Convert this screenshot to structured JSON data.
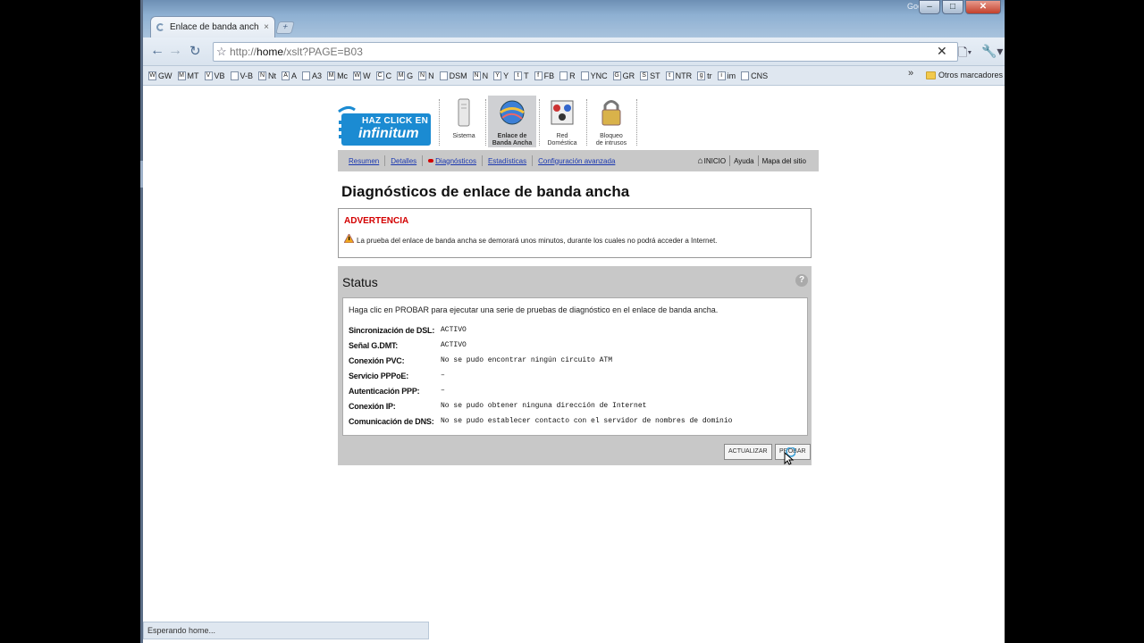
{
  "browser": {
    "tab_title": "Enlace de banda ancha: ...",
    "tab_close": "×",
    "new_tab": "+",
    "corner_label": "Google",
    "win_min": "–",
    "win_max": "□",
    "win_close": "✕",
    "url_prefix": "http://",
    "url_host": "home",
    "url_path": "/xslt?PAGE=B03",
    "omnibox_clear": "✕",
    "page_menu": "🗋▾",
    "wrench": "🔧▾",
    "bookmarks": [
      {
        "icon": "W",
        "label": "GW"
      },
      {
        "icon": "M",
        "label": "MT"
      },
      {
        "icon": "V",
        "label": "VB"
      },
      {
        "icon": "",
        "label": "V-B"
      },
      {
        "icon": "N",
        "label": "Nt"
      },
      {
        "icon": "A",
        "label": "A"
      },
      {
        "icon": "",
        "label": "A3"
      },
      {
        "icon": "M",
        "label": "Mc"
      },
      {
        "icon": "W",
        "label": "W"
      },
      {
        "icon": "C",
        "label": "C"
      },
      {
        "icon": "M",
        "label": "G"
      },
      {
        "icon": "N",
        "label": "N"
      },
      {
        "icon": "",
        "label": "DSM"
      },
      {
        "icon": "N",
        "label": "N"
      },
      {
        "icon": "Y",
        "label": "Y"
      },
      {
        "icon": "t",
        "label": "T"
      },
      {
        "icon": "f",
        "label": "FB"
      },
      {
        "icon": "",
        "label": "R"
      },
      {
        "icon": "",
        "label": "YNC"
      },
      {
        "icon": "G",
        "label": "GR"
      },
      {
        "icon": "S",
        "label": "ST"
      },
      {
        "icon": "t",
        "label": "NTR"
      },
      {
        "icon": "g",
        "label": "tr"
      },
      {
        "icon": "i",
        "label": "im"
      },
      {
        "icon": "",
        "label": "CNS"
      }
    ],
    "bookmarks_more": "»",
    "bookmarks_other": "Otros marcadores",
    "status_text": "Esperando home..."
  },
  "logo": {
    "line1": "HAZ CLICK EN",
    "line2": "infinitum"
  },
  "topnav": [
    {
      "line1": "Sistema",
      "line2": ""
    },
    {
      "line1": "Enlace de",
      "line2": "Banda Ancha"
    },
    {
      "line1": "Red",
      "line2": "Doméstica"
    },
    {
      "line1": "Bloqueo",
      "line2": "de intrusos"
    }
  ],
  "subnav": {
    "items": [
      "Resumen",
      "Detalles",
      "Diagnósticos",
      "Estadísticas",
      "Configuración avanzada"
    ],
    "inicio": "INICIO",
    "ayuda": "Ayuda",
    "mapa": "Mapa del sitio"
  },
  "page_title": "Diagnósticos de enlace de banda ancha",
  "warning": {
    "title": "ADVERTENCIA",
    "message": "La prueba del enlace de banda ancha se demorará unos minutos, durante los cuales no podrá acceder a Internet."
  },
  "status": {
    "header": "Status",
    "help": "?",
    "intro": "Haga clic en PROBAR para ejecutar una serie de pruebas de diagnóstico en el enlace de banda ancha.",
    "rows": [
      {
        "label": "Sincronización de DSL:",
        "value": "ACTIVO"
      },
      {
        "label": "Señal G.DMT:",
        "value": "ACTIVO"
      },
      {
        "label": "Conexión PVC:",
        "value": "No se pudo encontrar ningún circuito ATM"
      },
      {
        "label": "Servicio PPPoE:",
        "value": "–"
      },
      {
        "label": "Autenticación PPP:",
        "value": "–"
      },
      {
        "label": "Conexión IP:",
        "value": "No se pudo obtener ninguna dirección de Internet"
      },
      {
        "label": "Comunicación de DNS:",
        "value": "No se pudo establecer contacto con el servidor de nombres de dominio"
      }
    ],
    "btn_actualizar": "ACTUALIZAR",
    "btn_probar": "PROBAR"
  }
}
